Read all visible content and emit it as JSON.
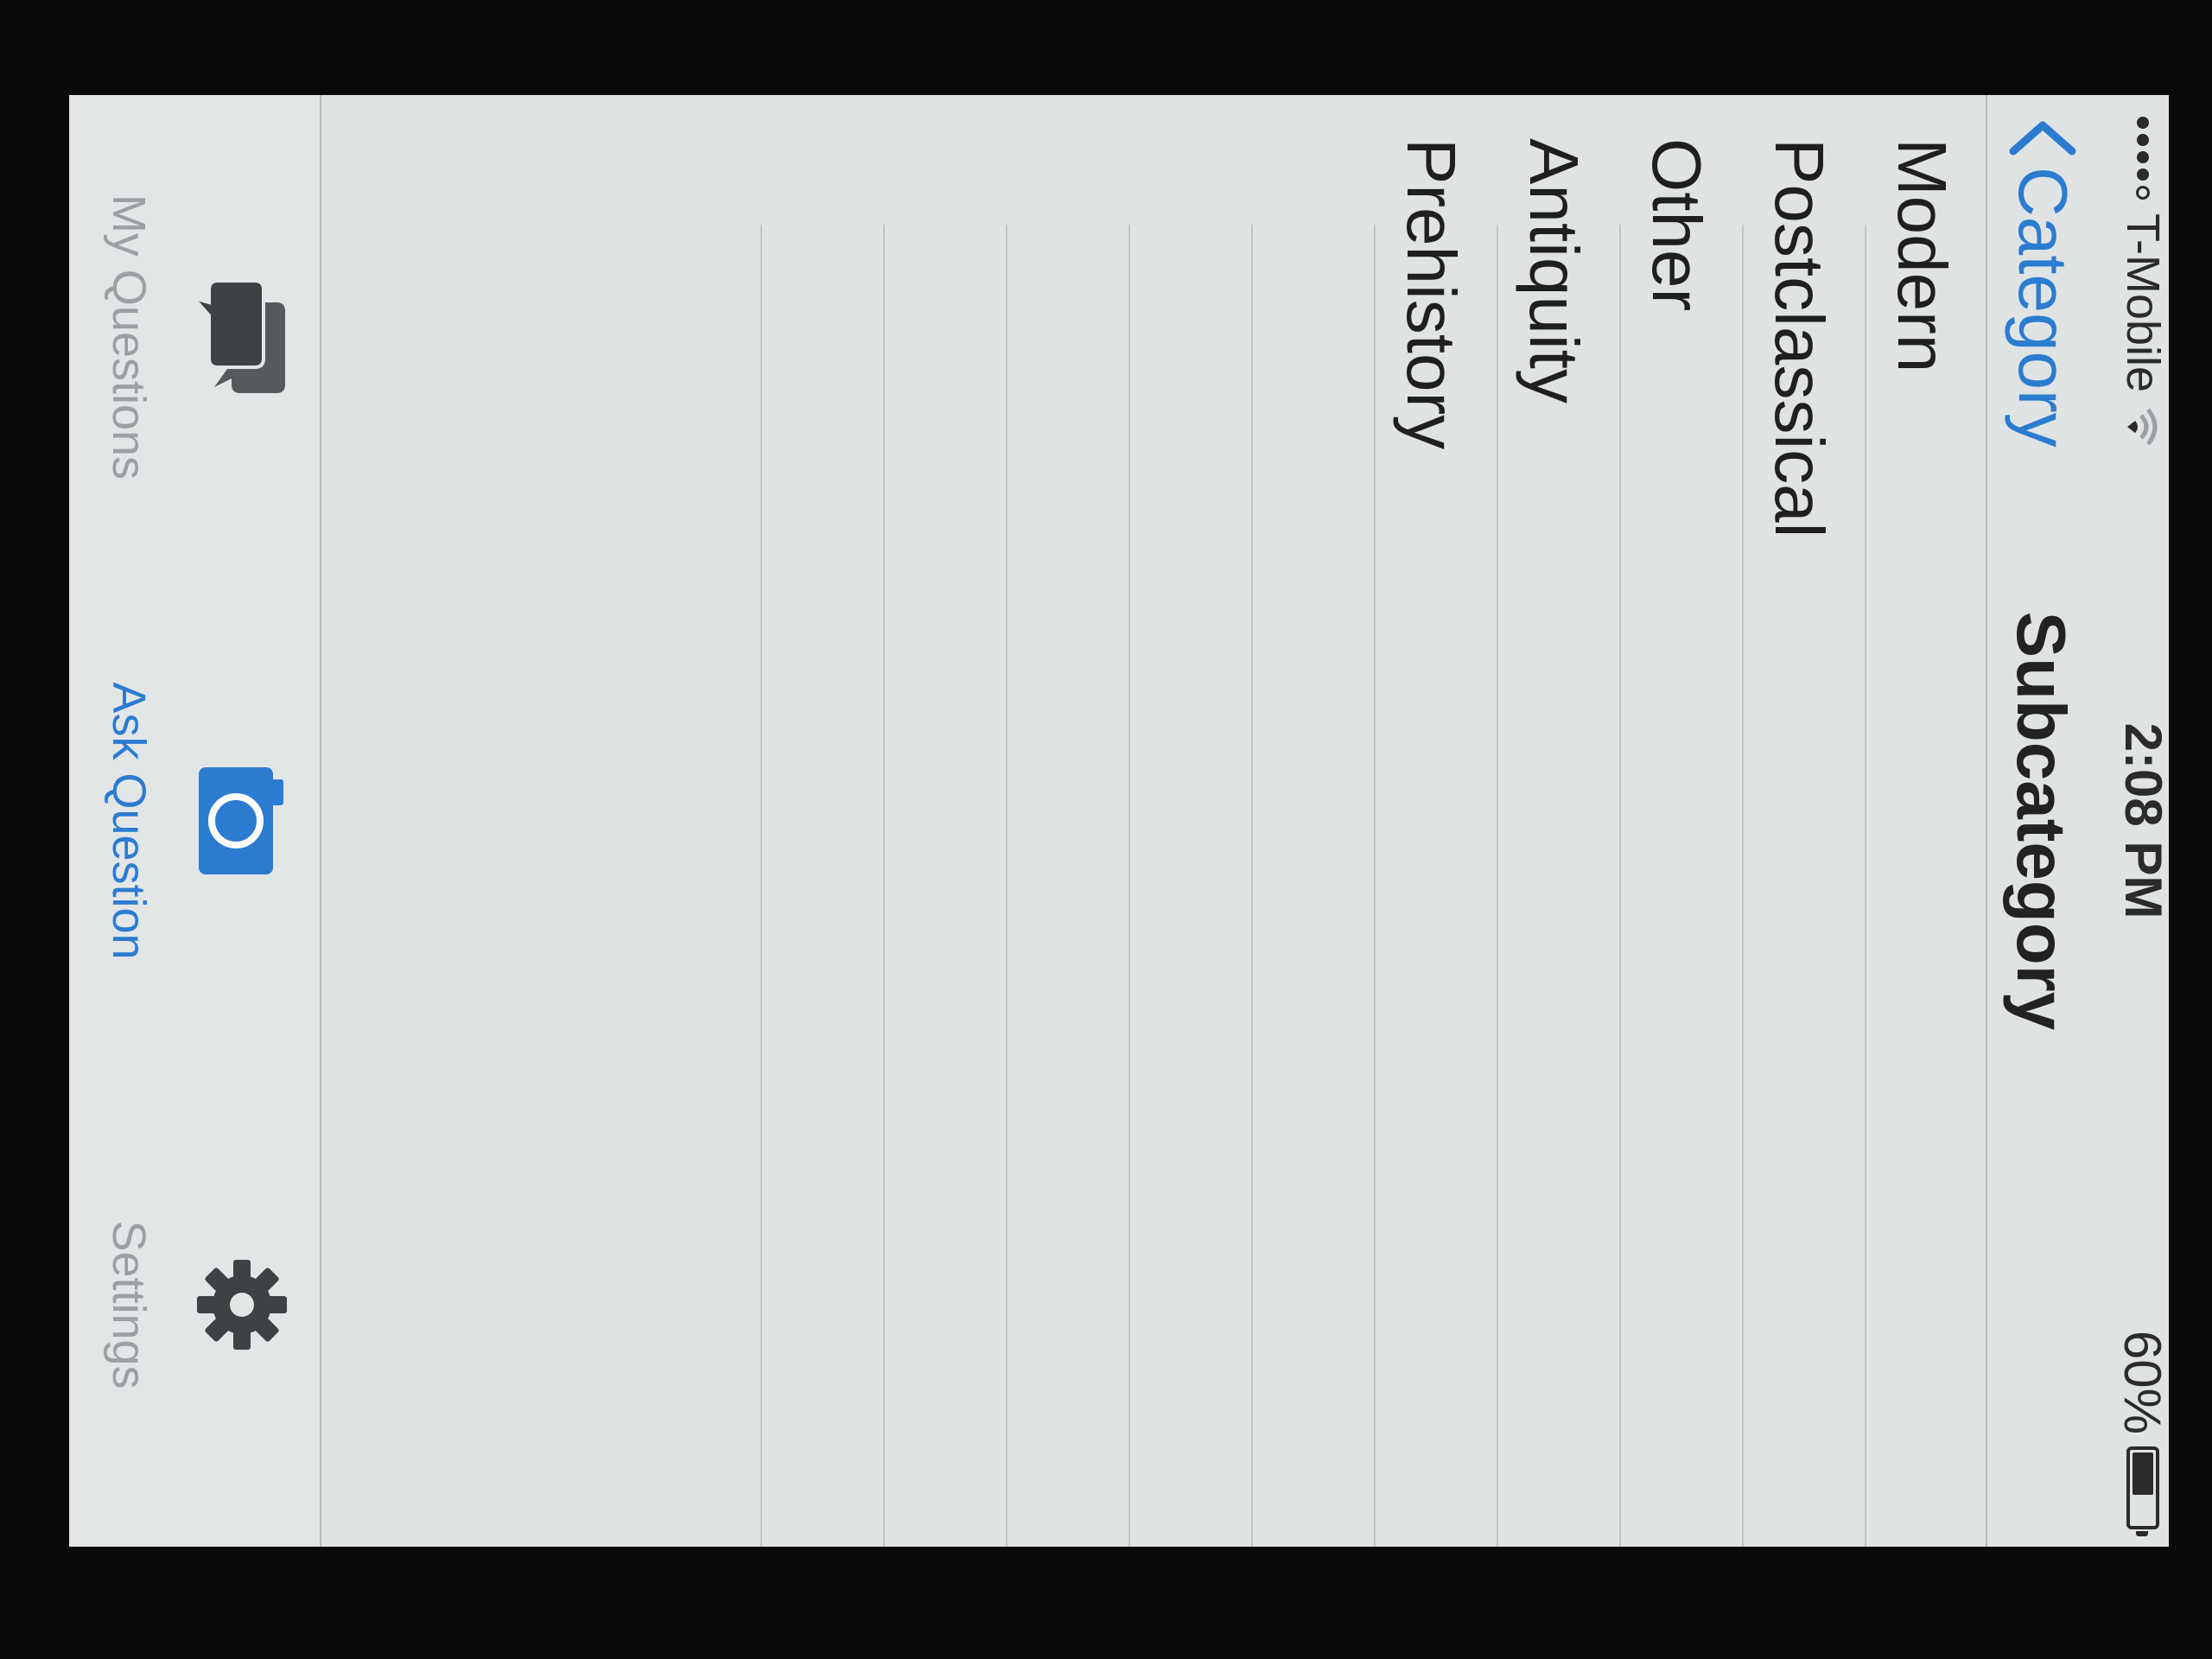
{
  "status_bar": {
    "carrier": "T-Mobile",
    "time": "2:08 PM",
    "battery_percent": "60%",
    "battery_level": 0.6
  },
  "nav": {
    "back_label": "Category",
    "title": "Subcategory"
  },
  "list": {
    "items": [
      "Modern",
      "Postclassical",
      "Other",
      "Antiquity",
      "Prehistory"
    ]
  },
  "tabs": [
    {
      "label": "My Questions",
      "icon": "chat-bubbles-icon",
      "active": false
    },
    {
      "label": "Ask Question",
      "icon": "camera-icon",
      "active": true
    },
    {
      "label": "Settings",
      "icon": "gear-icon",
      "active": false
    }
  ],
  "colors": {
    "accent": "#2b7cd0",
    "background": "#dfe3e4",
    "inactive_tab": "#9aa0a3"
  }
}
